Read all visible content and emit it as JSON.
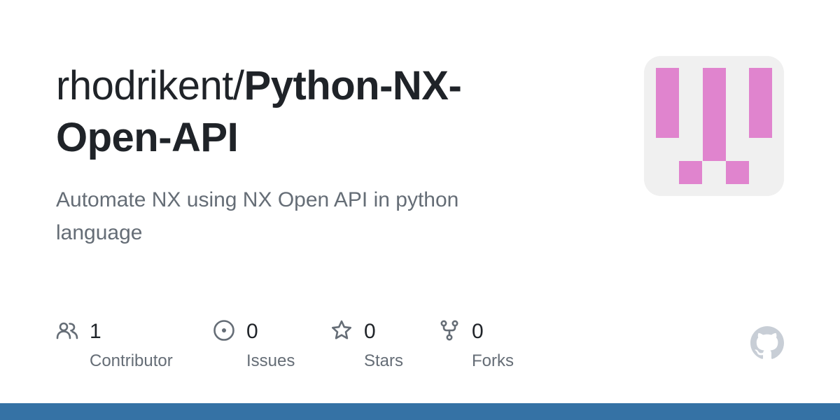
{
  "repo": {
    "owner": "rhodrikent/",
    "name": "Python-NX-Open-API",
    "description": "Automate NX using NX Open API in python language"
  },
  "stats": [
    {
      "count": "1",
      "label": "Contributor",
      "icon": "people-icon"
    },
    {
      "count": "0",
      "label": "Issues",
      "icon": "issue-opened-icon"
    },
    {
      "count": "0",
      "label": "Stars",
      "icon": "star-icon"
    },
    {
      "count": "0",
      "label": "Forks",
      "icon": "repo-forked-icon"
    }
  ],
  "colors": {
    "text_primary": "#1f2328",
    "text_muted": "#656d76",
    "avatar_bg": "#f0f0f0",
    "avatar_pixel": "#e084ce",
    "bottom_bar": "#3572a5",
    "logo": "#c8ced6"
  }
}
